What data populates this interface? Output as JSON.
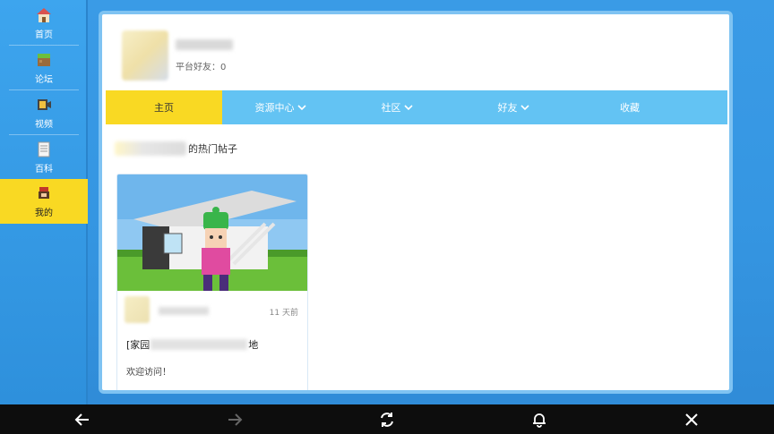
{
  "sidebar": {
    "items": [
      {
        "label": "首页",
        "icon": "home-icon"
      },
      {
        "label": "论坛",
        "icon": "forum-icon"
      },
      {
        "label": "视频",
        "icon": "video-icon"
      },
      {
        "label": "百科",
        "icon": "wiki-icon"
      },
      {
        "label": "我的",
        "icon": "profile-icon",
        "active": true
      }
    ]
  },
  "profile": {
    "friends_label": "平台好友：0"
  },
  "tabs": [
    {
      "label": "主页",
      "active": true,
      "dropdown": false
    },
    {
      "label": "资源中心",
      "dropdown": true
    },
    {
      "label": "社区",
      "dropdown": true
    },
    {
      "label": "好友",
      "dropdown": true
    },
    {
      "label": "收藏",
      "dropdown": false
    }
  ],
  "section": {
    "title_suffix": "的热门帖子"
  },
  "post": {
    "time": "11 天前",
    "title_prefix": "[家园",
    "title_suffix": "地",
    "body": "欢迎访问！"
  },
  "colors": {
    "accent_yellow": "#f9d923",
    "tab_blue": "#63c3f3",
    "background_blue": "#3596e2"
  },
  "bottombar": {
    "icons": [
      "back-arrow-icon",
      "forward-arrow-icon",
      "refresh-icon",
      "bell-icon",
      "close-icon"
    ]
  }
}
